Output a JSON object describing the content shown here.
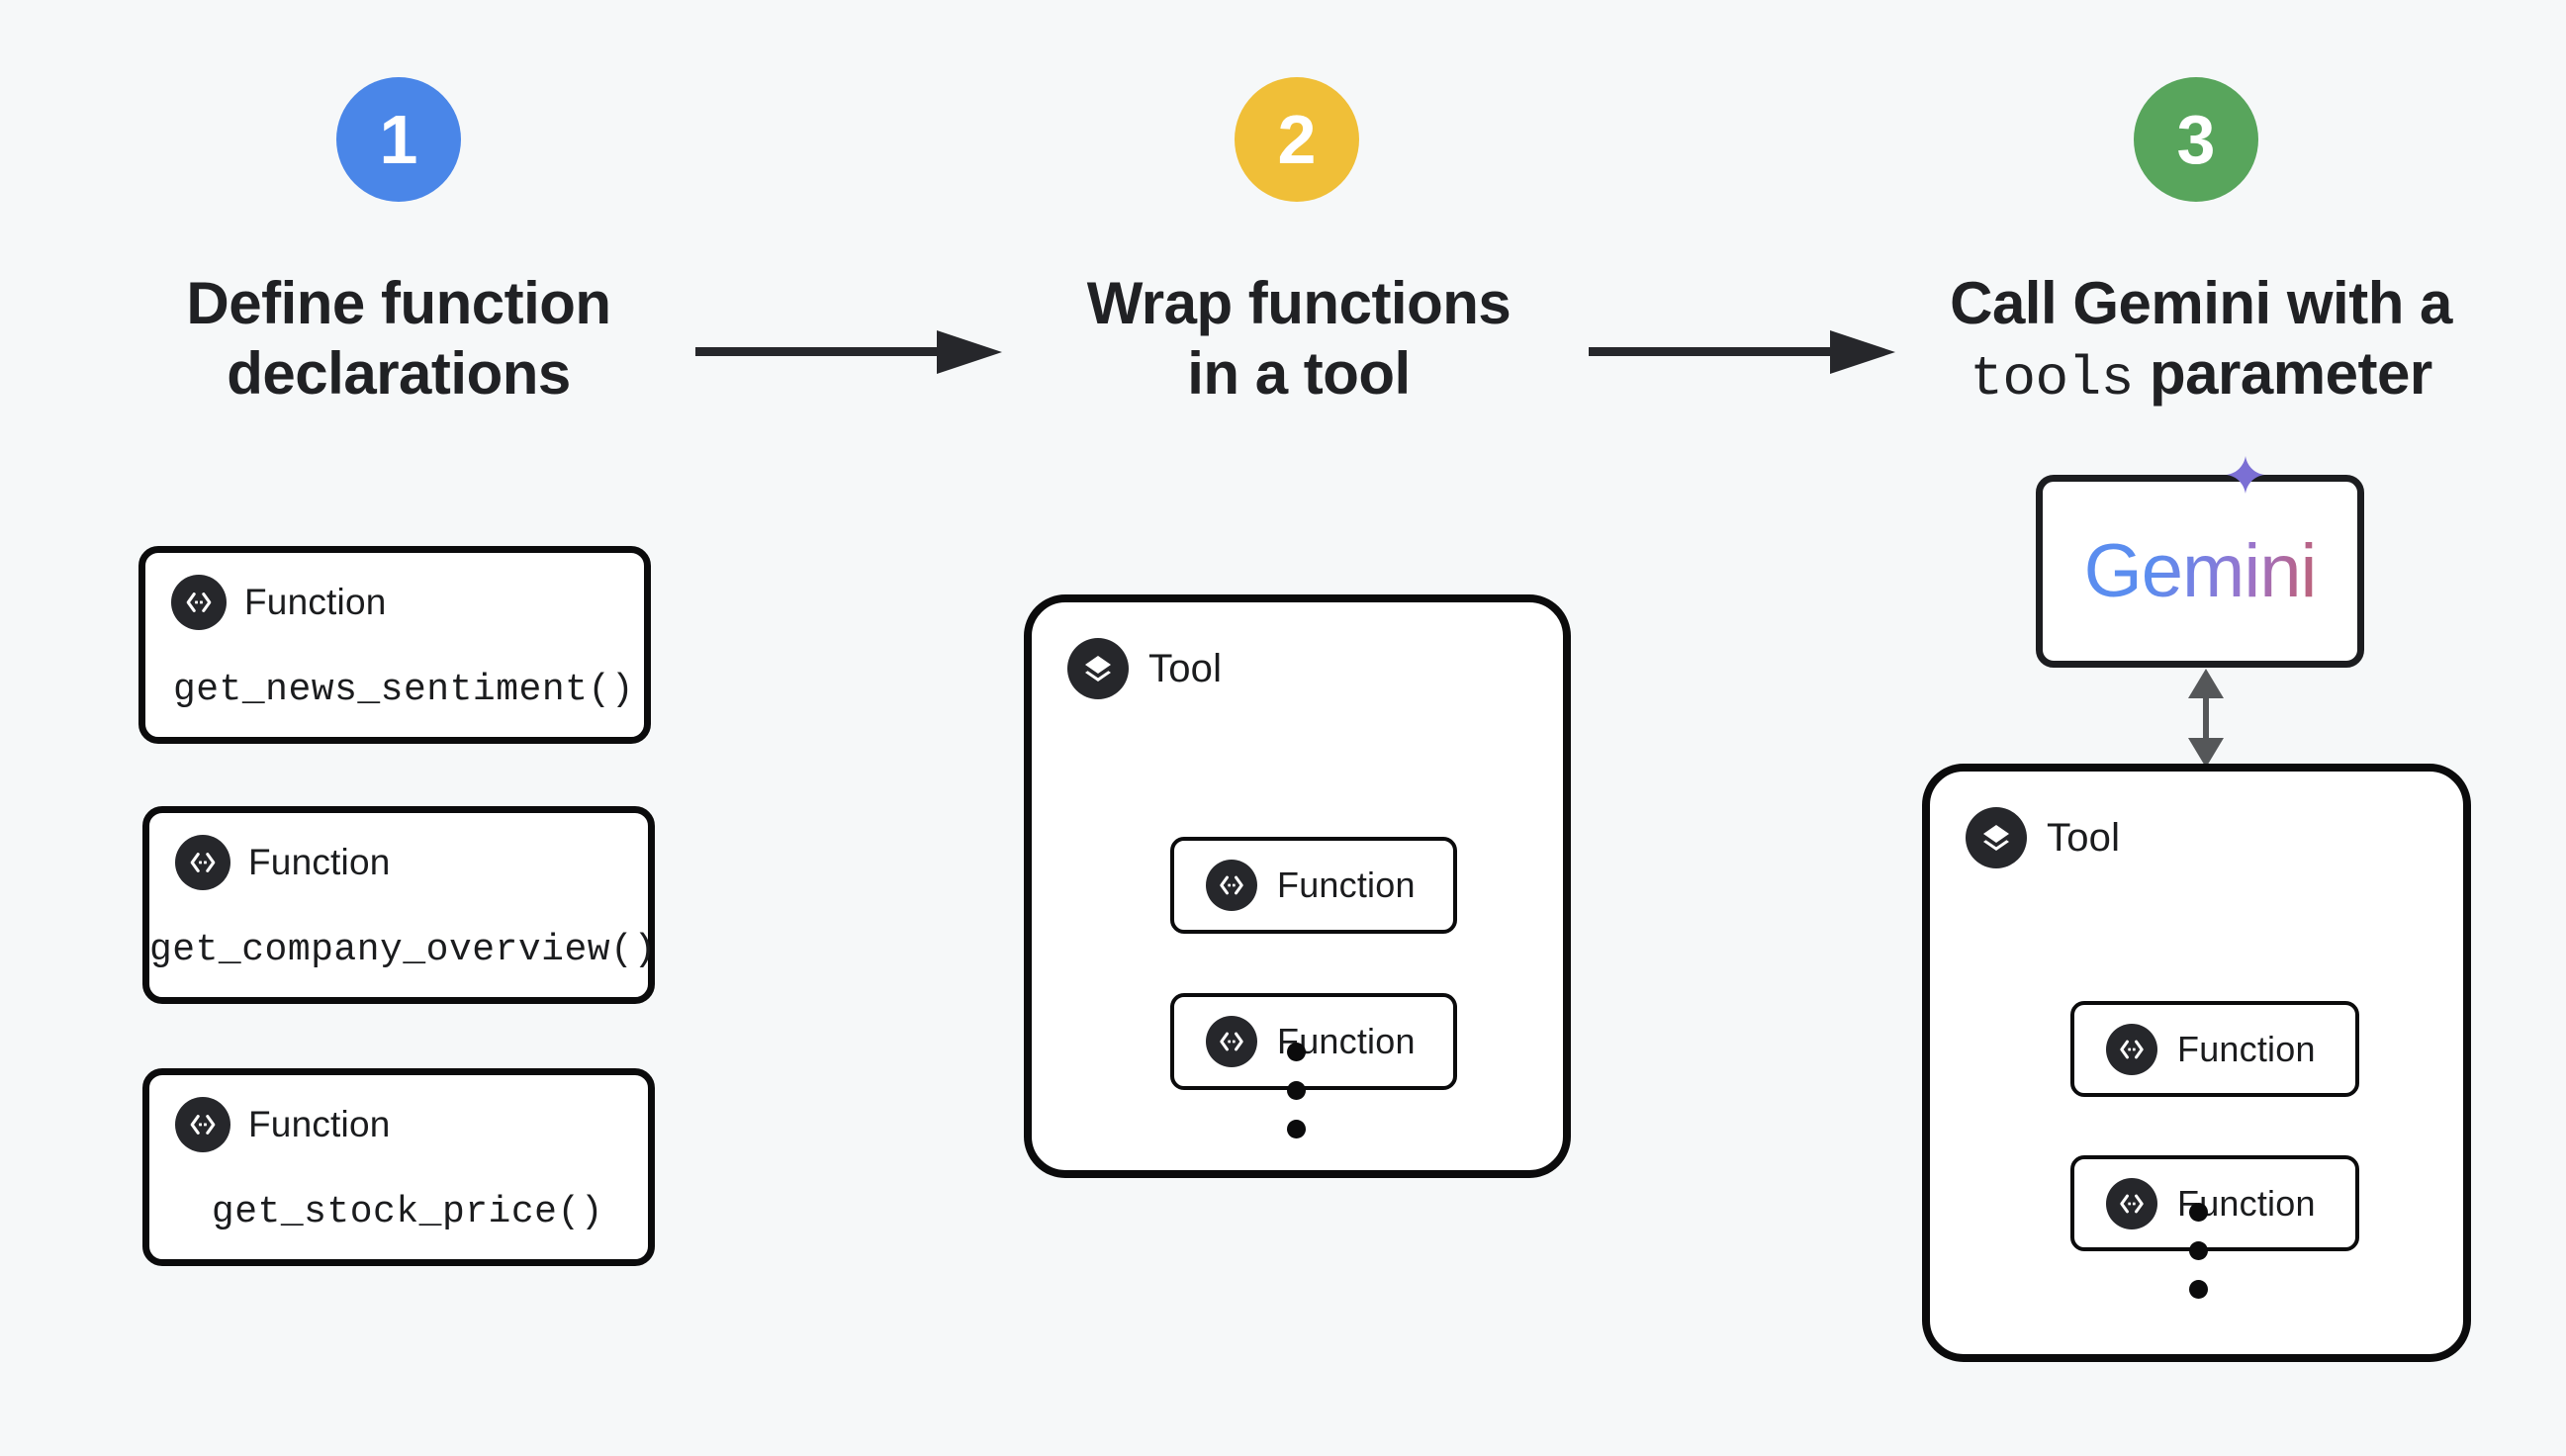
{
  "diagram": {
    "title": "Gemini function calling workflow",
    "background_color": "#f6f8f9"
  },
  "colors": {
    "step1_badge": "#4a86e8",
    "step2_badge": "#f0bf38",
    "step3_badge": "#58a55c",
    "outline": "#0b0b0c",
    "icon_circle": "#26272b",
    "text": "#202124",
    "arrow_horizontal": "#26272b",
    "arrow_vertical": "#555759",
    "gemini_gradient_start": "#5b8def",
    "gemini_gradient_end": "#bd6275",
    "sparkle": "#7b6fd4"
  },
  "steps": [
    {
      "number": "1",
      "title_line1": "Define function",
      "title_line2": "declarations"
    },
    {
      "number": "2",
      "title_line1": "Wrap functions",
      "title_line2": "in a tool"
    },
    {
      "number": "3",
      "title_line1": "Call Gemini with a",
      "title_line2_mono": "tools",
      "title_line2_rest": " parameter"
    }
  ],
  "step1": {
    "function_cards": [
      {
        "badge_label": "Function",
        "name": "get_news_sentiment()"
      },
      {
        "badge_label": "Function",
        "name": "get_company_overview()"
      },
      {
        "badge_label": "Function",
        "name": "get_stock_price()"
      }
    ]
  },
  "step2": {
    "tool": {
      "label": "Tool",
      "functions": [
        {
          "label": "Function"
        },
        {
          "label": "Function"
        }
      ],
      "more_indicator": "vertical-ellipsis"
    }
  },
  "step3": {
    "gemini_card": {
      "wordmark": "Gemini"
    },
    "tool": {
      "label": "Tool",
      "functions": [
        {
          "label": "Function"
        },
        {
          "label": "Function"
        }
      ],
      "more_indicator": "vertical-ellipsis"
    }
  },
  "connectors": {
    "arrow_1_to_2": "right-arrow",
    "arrow_2_to_3": "right-arrow",
    "gemini_tool_link": "double-headed-vertical-arrow"
  }
}
